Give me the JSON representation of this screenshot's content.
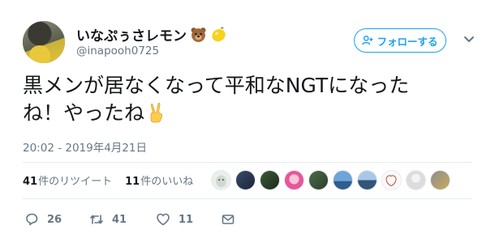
{
  "user": {
    "display_name": "いなぷぅさレモン",
    "handle": "@inapooh0725",
    "name_emojis": [
      "bear-face-icon",
      "lemon-icon"
    ]
  },
  "follow_button": {
    "label": "フォローする"
  },
  "tweet": {
    "text_line1": "黒メンが居なくなって平和なNGTになった",
    "text_line2": "ね！やったね",
    "trailing_emoji": "victory-hand-icon"
  },
  "timestamp": "20:02 - 2019年4月21日",
  "stats": {
    "retweet_count": "41",
    "retweet_label": "件のリツイート",
    "like_count": "11",
    "like_label": "件のいいね"
  },
  "actions": {
    "reply_count": "26",
    "retweet_count": "41",
    "like_count": "11"
  },
  "colors": {
    "accent": "#1da1f2",
    "muted": "#657786",
    "text": "#14171a"
  }
}
